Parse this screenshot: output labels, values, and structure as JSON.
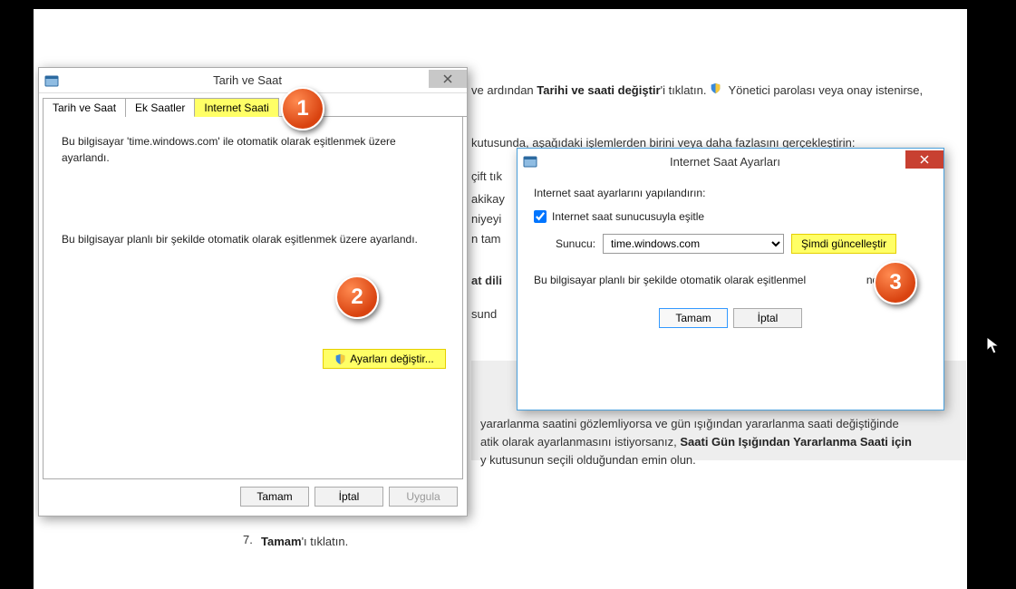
{
  "background": {
    "line1_pre": "ve ardından ",
    "line1_bold": "Tarihi ve saati değiştir",
    "line1_post": "'i tıklatın. ",
    "line1_tail": " Yönetici parolası veya onay istenirse,",
    "line2": "kutusunda, aşağıdaki işlemlerden birini veya daha fazlasını gerçekleştirin:",
    "frag1": "çift tık",
    "frag2": "akikay",
    "frag3": "niyeyi",
    "frag4": "n tam",
    "frag5": "at dili",
    "frag6": "sund",
    "box_line1": "yararlanma saatini gözlemliyorsa ve gün ışığından yararlanma saati değiştiğinde",
    "box_line2_pre": "atik olarak ayarlanmasını istiyorsanız, ",
    "box_line2_bold": "Saati Gün Işığından Yararlanma Saati için",
    "box_line3": "y kutusunun seçili olduğundan emin olun.",
    "listnum": "7.",
    "listtext_bold": "Tamam",
    "listtext_post": "'ı tıklatın."
  },
  "dialog1": {
    "title": "Tarih ve Saat",
    "tabs": [
      "Tarih ve Saat",
      "Ek Saatler",
      "Internet Saati"
    ],
    "info1": "Bu bilgisayar 'time.windows.com' ile otomatik olarak eşitlenmek üzere ayarlandı.",
    "info2": "Bu bilgisayar planlı bir şekilde otomatik olarak eşitlenmek üzere ayarlandı.",
    "change_settings": "Ayarları değiştir...",
    "ok": "Tamam",
    "cancel": "İptal",
    "apply": "Uygula"
  },
  "dialog2": {
    "title": "Internet Saat Ayarları",
    "heading": "Internet saat ayarlarını yapılandırın:",
    "checkbox_label": "Internet saat sunucusuyla eşitle",
    "server_label": "Sunucu:",
    "server_value": "time.windows.com",
    "update_now": "Şimdi güncelleştir",
    "status_pre": "Bu bilgisayar planlı bir şekilde otomatik olarak eşitlenmel",
    "status_post": "ndı.",
    "ok": "Tamam",
    "cancel": "İptal"
  },
  "bubbles": {
    "b1": "1",
    "b2": "2",
    "b3": "3"
  }
}
